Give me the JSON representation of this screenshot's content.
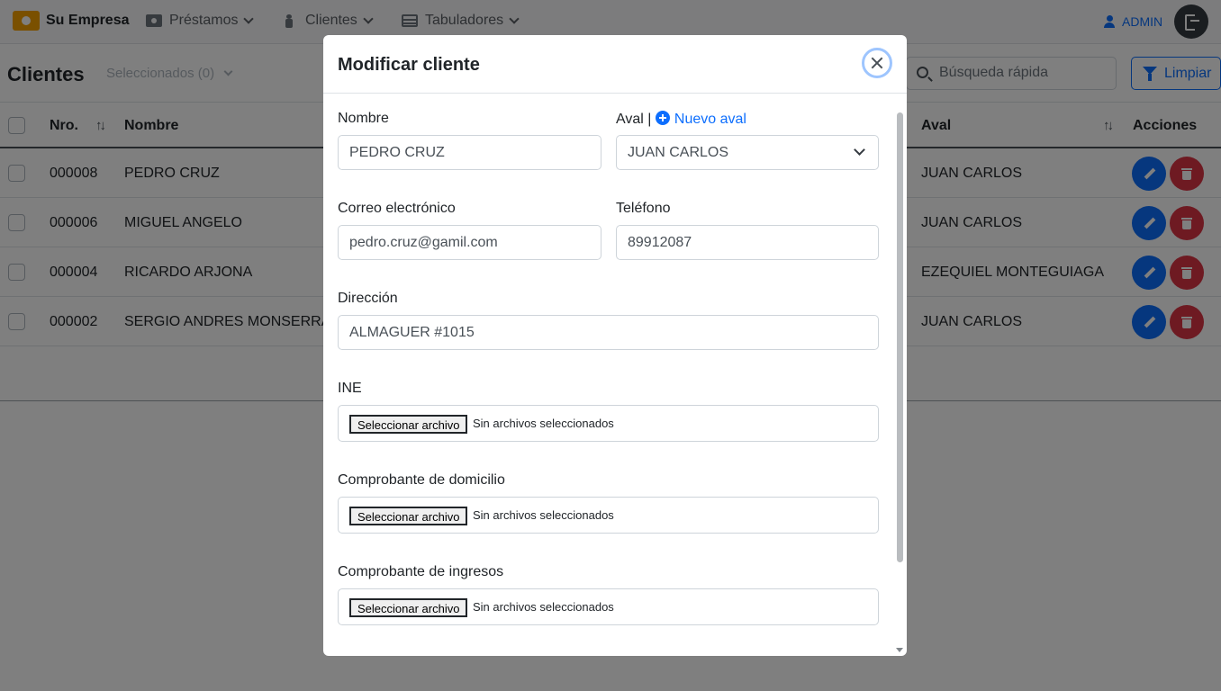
{
  "navbar": {
    "brand": "Su Empresa",
    "menu": [
      {
        "label": "Préstamos",
        "icon": "cash-icon"
      },
      {
        "label": "Clientes",
        "icon": "person-icon"
      },
      {
        "label": "Tabuladores",
        "icon": "table-icon"
      }
    ],
    "user": "ADMIN"
  },
  "page": {
    "title": "Clientes",
    "selected_label": "Seleccionados (0)",
    "search_placeholder": "Búsqueda rápida",
    "clear_label": "Limpiar"
  },
  "table": {
    "columns": {
      "nro": "Nro.",
      "nombre": "Nombre",
      "aval": "Aval",
      "acciones": "Acciones"
    },
    "rows": [
      {
        "nro": "000008",
        "nombre": "PEDRO CRUZ",
        "aval": "JUAN CARLOS"
      },
      {
        "nro": "000006",
        "nombre": "MIGUEL ANGELO",
        "aval": "JUAN CARLOS"
      },
      {
        "nro": "000004",
        "nombre": "RICARDO ARJONA",
        "aval": "EZEQUIEL MONTEGUIAGA"
      },
      {
        "nro": "000002",
        "nombre": "SERGIO ANDRES MONSERRAT",
        "aval": "JUAN CARLOS"
      }
    ]
  },
  "modal": {
    "title": "Modificar cliente",
    "fields": {
      "nombre": {
        "label": "Nombre",
        "value": "PEDRO CRUZ"
      },
      "aval": {
        "label": "Aval |",
        "link": "Nuevo aval",
        "value": "JUAN CARLOS"
      },
      "correo": {
        "label": "Correo electrónico",
        "value": "pedro.cruz@gamil.com"
      },
      "telefono": {
        "label": "Teléfono",
        "value": "89912087"
      },
      "direccion": {
        "label": "Dirección",
        "value": "ALMAGUER #1015"
      }
    },
    "files": [
      {
        "label": "INE",
        "button": "Seleccionar archivo",
        "status": "Sin archivos seleccionados"
      },
      {
        "label": "Comprobante de domicilio",
        "button": "Seleccionar archivo",
        "status": "Sin archivos seleccionados"
      },
      {
        "label": "Comprobante de ingresos",
        "button": "Seleccionar archivo",
        "status": "Sin archivos seleccionados"
      }
    ]
  },
  "colors": {
    "primary": "#0d6efd",
    "danger": "#dc3545",
    "brand": "#f5a000",
    "dark": "#343a40"
  }
}
